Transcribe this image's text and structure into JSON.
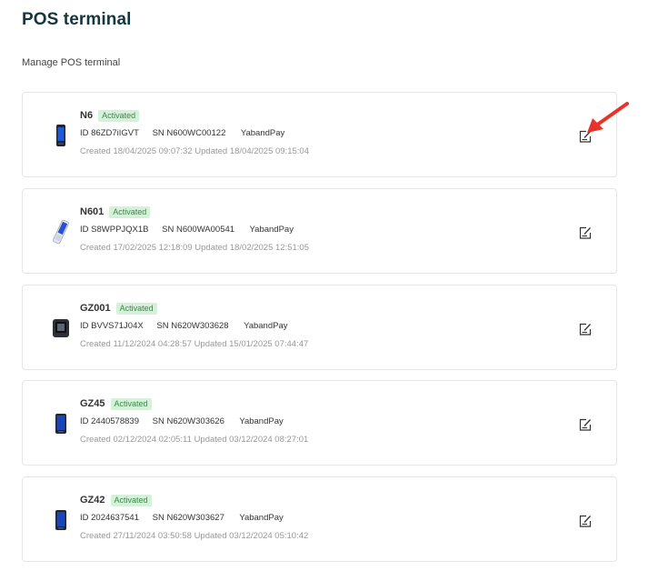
{
  "header": {
    "title": "POS terminal",
    "subtitle": "Manage POS terminal"
  },
  "terminals": [
    {
      "name": "N6",
      "status": "Activated",
      "id_label": "ID",
      "id": "86ZD7iIGVT",
      "sn_label": "SN",
      "sn": "N600WC00122",
      "company": "YabandPay",
      "created_label": "Created",
      "created": "18/04/2025 09:07:32",
      "updated_label": "Updated",
      "updated": "18/04/2025 09:15:04",
      "device_icon": "handheld-terminal-icon"
    },
    {
      "name": "N601",
      "status": "Activated",
      "id_label": "ID",
      "id": "S8WPPJQX1B",
      "sn_label": "SN",
      "sn": "N600WA00541",
      "company": "YabandPay",
      "created_label": "Created",
      "created": "17/02/2025 12:18:09",
      "updated_label": "Updated",
      "updated": "18/02/2025 12:51:05",
      "device_icon": "tilted-terminal-icon"
    },
    {
      "name": "GZ001",
      "status": "Activated",
      "id_label": "ID",
      "id": "BVVS71J04X",
      "sn_label": "SN",
      "sn": "N620W303628",
      "company": "YabandPay",
      "created_label": "Created",
      "created": "11/12/2024 04:28:57",
      "updated_label": "Updated",
      "updated": "15/01/2025 07:44:47",
      "device_icon": "square-terminal-icon"
    },
    {
      "name": "GZ45",
      "status": "Activated",
      "id_label": "ID",
      "id": "2440578839",
      "sn_label": "SN",
      "sn": "N620W303626",
      "company": "YabandPay",
      "created_label": "Created",
      "created": "02/12/2024 02:05:11",
      "updated_label": "Updated",
      "updated": "03/12/2024 08:27:01",
      "device_icon": "handheld-terminal-icon"
    },
    {
      "name": "GZ42",
      "status": "Activated",
      "id_label": "ID",
      "id": "2024637541",
      "sn_label": "SN",
      "sn": "N620W303627",
      "company": "YabandPay",
      "created_label": "Created",
      "created": "27/11/2024 03:50:58",
      "updated_label": "Updated",
      "updated": "03/12/2024 05:10:42",
      "device_icon": "handheld-terminal-icon"
    }
  ],
  "colors": {
    "title": "#14373f",
    "badge_bg": "#d6f1da",
    "badge_text": "#3a8a48",
    "annotation_arrow": "#e8332a"
  }
}
